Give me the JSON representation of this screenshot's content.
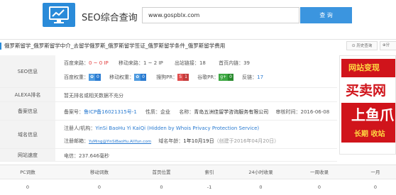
{
  "header": {
    "title": "SEO综合查询",
    "search_value": "www.gospblx.com",
    "search_button": "查 询"
  },
  "page": {
    "title": "俄罗斯留学_俄罗斯留学中介_去留学俄罗斯_俄罗斯留学签证_俄罗斯留学条件_俄罗斯留学费用",
    "history_label": "历史查询",
    "share_label": "分"
  },
  "seo_info": {
    "label": "SEO信息",
    "line1": {
      "baidu_traffic_label": "百度来路：",
      "baidu_traffic_value": "0 ~ 0 IP",
      "mobile_traffic_label": "移动来路：",
      "mobile_traffic_value": "1 ~ 2 IP",
      "outlinks_label": "出站链接：",
      "outlinks_value": "18",
      "homepage_links_label": "首页内链：",
      "homepage_links_value": "39"
    },
    "line2": {
      "baidu_weight_label": "百度权重：",
      "baidu_weight_value": "0",
      "mobile_weight_label": "移动权重：",
      "mobile_weight_value": "0",
      "sogou_pr_label": "搜狗PR：",
      "sogou_pr_value": "1",
      "google_pr_label": "谷歌PR：",
      "google_pr_value": "0",
      "backlinks_label": "反链：",
      "backlinks_value": "17"
    }
  },
  "alexa": {
    "label": "ALEXA排名",
    "text": "暂无排名或相关数据不充分"
  },
  "icp": {
    "label": "备案信息",
    "number_label": "备案号：",
    "number_value": "鲁ICP备16021315号-1",
    "nature_label": "性质：",
    "nature_value": "企业",
    "name_label": "名称：",
    "name_value": "青岛五洲佳留学咨询服务有限公司",
    "date_label": "审核时间：",
    "date_value": "2016-06-08"
  },
  "domain": {
    "label": "域名信息",
    "registrant_label": "注册人/机构：",
    "registrant_value": "YinSi BaoHu Yi KaiQi (Hidden by Whois Privacy Protection Service)",
    "email_label": "注册邮箱：",
    "email_value": "YuMing@YinSiBaoHu.AliYun.com",
    "age_label": "域名年龄：",
    "age_value": "1年10月19日",
    "created_prefix": "（创建于",
    "created_value": "2016年04月20日",
    "created_suffix": "）"
  },
  "speed": {
    "label": "网站速度",
    "value": "电信：237.646毫秒"
  },
  "ad": {
    "top_text": "网站变现",
    "mid_text": "买卖网",
    "low_text": "上鱼爪",
    "foot_text": "长期 收站"
  },
  "bottom_table": {
    "headers": [
      "PC词数",
      "移动词数",
      "首页位置",
      "索引",
      "24小时收录",
      "一周收录",
      "一月"
    ],
    "values": [
      "0",
      "0",
      "0",
      "-1",
      "0",
      "0",
      "0"
    ]
  },
  "colors": {
    "brand_blue": "#2a8bd9",
    "search_button": "#3b95df",
    "ad_red": "#d0141b"
  }
}
